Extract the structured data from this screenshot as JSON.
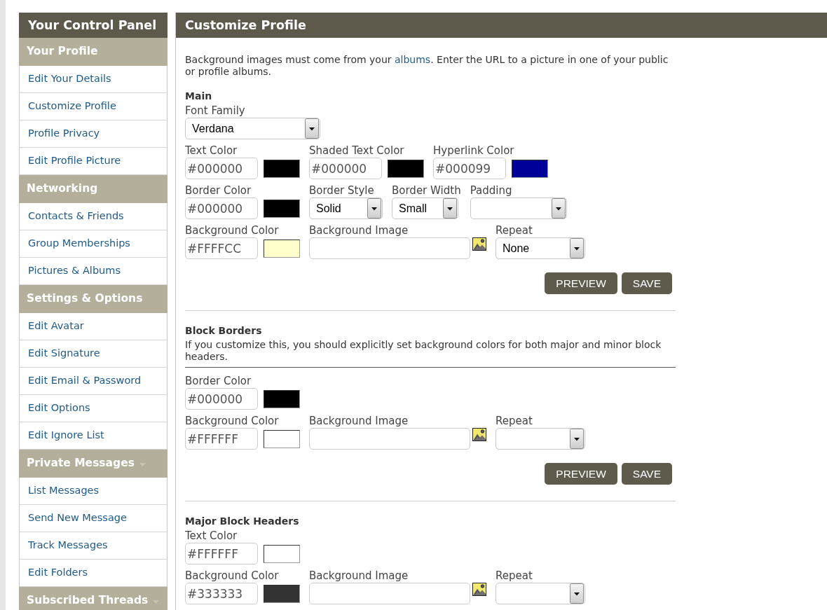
{
  "sidebar": {
    "title": "Your Control Panel",
    "sections": [
      {
        "title": "Your Profile",
        "dropdown": false,
        "items": [
          {
            "label": "Edit Your Details"
          },
          {
            "label": "Customize Profile"
          },
          {
            "label": "Profile Privacy"
          },
          {
            "label": "Edit Profile Picture"
          }
        ]
      },
      {
        "title": "Networking",
        "dropdown": false,
        "items": [
          {
            "label": "Contacts & Friends"
          },
          {
            "label": "Group Memberships"
          },
          {
            "label": "Pictures & Albums"
          }
        ]
      },
      {
        "title": "Settings & Options",
        "dropdown": false,
        "items": [
          {
            "label": "Edit Avatar"
          },
          {
            "label": "Edit Signature"
          },
          {
            "label": "Edit Email & Password"
          },
          {
            "label": "Edit Options"
          },
          {
            "label": "Edit Ignore List"
          }
        ]
      },
      {
        "title": "Private Messages",
        "dropdown": true,
        "items": [
          {
            "label": "List Messages"
          },
          {
            "label": "Send New Message"
          },
          {
            "label": "Track Messages"
          },
          {
            "label": "Edit Folders"
          }
        ]
      },
      {
        "title": "Subscribed Threads",
        "dropdown": true
      }
    ]
  },
  "panel": {
    "title": "Customize Profile",
    "intro": {
      "before": "Background images must come from your ",
      "link": "albums",
      "after": ". Enter the URL to a picture in one of your public or profile albums."
    },
    "sections": [
      {
        "title": "Main",
        "rows": [
          [
            {
              "kind": "select",
              "label": "Font Family",
              "value": "Verdana"
            }
          ],
          [
            {
              "kind": "color",
              "label": "Text Color",
              "value": "#000000",
              "color": "#000000"
            },
            {
              "kind": "color",
              "label": "Shaded Text Color",
              "value": "#000000",
              "color": "#000000"
            },
            {
              "kind": "color",
              "label": "Hyperlink Color",
              "value": "#000099",
              "color": "#000099"
            }
          ],
          [
            {
              "kind": "color",
              "label": "Border Color",
              "value": "#000000",
              "color": "#000000"
            },
            {
              "kind": "select",
              "label": "Border Style",
              "value": "Solid"
            },
            {
              "kind": "select",
              "label": "Border Width",
              "value": "Small"
            },
            {
              "kind": "select",
              "label": "Padding"
            }
          ],
          [
            {
              "kind": "color",
              "label": "Background Color",
              "value": "#FFFFCC",
              "color": "#ffffcc"
            },
            {
              "kind": "image",
              "label": "Background Image"
            },
            {
              "kind": "select",
              "label": "Repeat",
              "value": "None"
            }
          ]
        ],
        "buttons": [
          "PREVIEW",
          "SAVE"
        ]
      },
      {
        "title": "Block Borders",
        "description": "If you customize this, you should explicitly set background colors for both major and minor block headers.",
        "rows": [
          [
            {
              "kind": "color",
              "label": "Border Color",
              "value": "#000000",
              "color": "#000000"
            }
          ],
          [
            {
              "kind": "color",
              "label": "Background Color",
              "value": "#FFFFFF",
              "color": "#ffffff"
            },
            {
              "kind": "image",
              "label": "Background Image"
            },
            {
              "kind": "select",
              "label": "Repeat"
            }
          ]
        ],
        "buttons": [
          "PREVIEW",
          "SAVE"
        ]
      },
      {
        "title": "Major Block Headers",
        "rows": [
          [
            {
              "kind": "color",
              "label": "Text Color",
              "value": "#FFFFFF",
              "color": "#ffffff"
            }
          ],
          [
            {
              "kind": "color",
              "label": "Background Color",
              "value": "#333333",
              "color": "#333333"
            },
            {
              "kind": "image",
              "label": "Background Image"
            },
            {
              "kind": "select",
              "label": "Repeat"
            }
          ]
        ]
      }
    ]
  }
}
